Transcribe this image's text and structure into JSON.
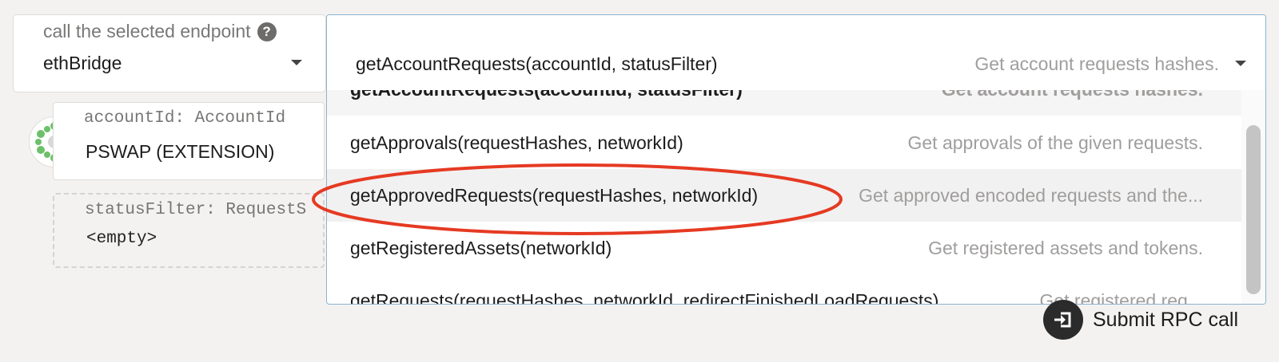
{
  "section": {
    "label": "call the selected endpoint",
    "value": "ethBridge",
    "help_icon": "question-circle-icon"
  },
  "params": [
    {
      "label": "accountId: AccountId",
      "value": "PSWAP (EXTENSION)"
    },
    {
      "label": "statusFilter: RequestS",
      "value": "<empty>"
    }
  ],
  "dropdown": {
    "selected_method": "getAccountRequests(accountId, statusFilter)",
    "selected_desc": "Get account requests hashes.",
    "items": [
      {
        "method": "getAccountRequests(accountId, statusFilter)",
        "desc": "Get account requests hashes."
      },
      {
        "method": "getApprovals(requestHashes, networkId)",
        "desc": "Get approvals of the given requests."
      },
      {
        "method": "getApprovedRequests(requestHashes, networkId)",
        "desc": "Get approved encoded requests and the..."
      },
      {
        "method": "getRegisteredAssets(networkId)",
        "desc": "Get registered assets and tokens."
      },
      {
        "method": "getRequests(requestHashes, networkId, redirectFinishedLoadRequests)",
        "desc": "Get registered req..."
      }
    ]
  },
  "submit": {
    "label": "Submit RPC call",
    "icon": "sign-in-icon"
  },
  "colors": {
    "annotation": "#e53a22",
    "dropdown_border": "#8ab3d1"
  }
}
